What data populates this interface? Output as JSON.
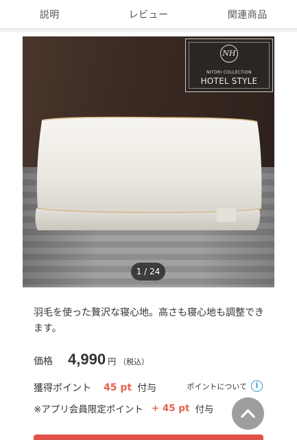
{
  "tabs": [
    {
      "label": "説明"
    },
    {
      "label": "レビュー"
    },
    {
      "label": "関連商品"
    }
  ],
  "gallery": {
    "badge": {
      "logo": "NH",
      "collection": "NITORI COLLECTION",
      "name": "HOTEL STYLE"
    },
    "counter": "1 / 24"
  },
  "product": {
    "description": "羽毛を使った贅沢な寝心地。高さも寝心地も調整できます。"
  },
  "price": {
    "label": "価格",
    "value": "4,990",
    "unit": "円",
    "tax": "（税込）"
  },
  "points": {
    "label": "獲得ポイント",
    "value": "45 pt",
    "suffix": "付与",
    "info_label": "ポイントについて",
    "info_icon": "info-icon"
  },
  "app_points": {
    "label": "※アプリ会員限定ポイント",
    "value": "+ 45 pt",
    "suffix": "付与"
  },
  "scroll_top": {
    "icon": "chevron-up-icon"
  },
  "colors": {
    "accent_red": "#e8604c",
    "info_blue": "#3a9bd6"
  }
}
